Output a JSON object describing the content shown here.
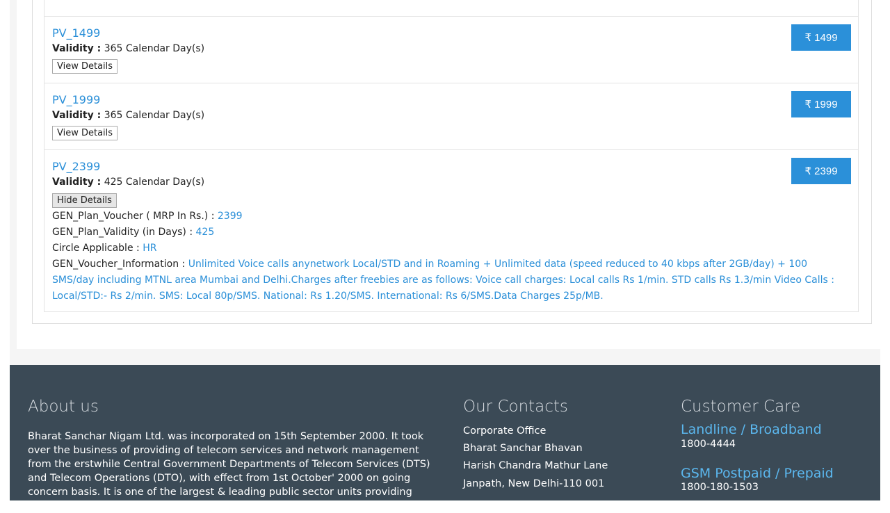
{
  "plans": [
    {
      "name": "PV_1499",
      "validity_label": "Validity :",
      "validity": "365 Calendar Day(s)",
      "button": "View Details",
      "price": "₹ 1499"
    },
    {
      "name": "PV_1999",
      "validity_label": "Validity :",
      "validity": "365 Calendar Day(s)",
      "button": "View Details",
      "price": "₹ 1999"
    },
    {
      "name": "PV_2399",
      "validity_label": "Validity :",
      "validity": "425 Calendar Day(s)",
      "button": "Hide Details",
      "price": "₹ 2399",
      "details": {
        "mrp_label": "GEN_Plan_Voucher ( MRP In Rs.) :",
        "mrp_value": "2399",
        "validity_days_label": "GEN_Plan_Validity (in Days) :",
        "validity_days_value": "425",
        "circle_label": "Circle Applicable :",
        "circle_value": "HR",
        "info_label": "GEN_Voucher_Information :",
        "info_value": "Unlimited Voice calls anynetwork Local/STD and in Roaming + Unlimited data (speed reduced to 40 kbps after 2GB/day) + 100 SMS/day including MTNL area Mumbai and Delhi.Charges after freebies are as follows: Voice call charges: Local calls Rs 1/min. STD calls Rs 1.3/min Video Calls : Local/STD:- Rs 2/min. SMS: Local 80p/SMS. National: Rs 1.20/SMS. International: Rs 6/SMS.Data Charges 25p/MB."
      }
    }
  ],
  "footer": {
    "about": {
      "heading": "About us",
      "text": "Bharat Sanchar Nigam Ltd. was incorporated on 15th September 2000. It took over the business of providing of telecom services and network management from the erstwhile Central Government Departments of Telecom Services (DTS) and Telecom Operations (DTO), with effect from 1st October' 2000 on going concern basis. It is one of the largest & leading public sector units providing comprehensive range of"
    },
    "contacts": {
      "heading": "Our Contacts",
      "lines": [
        "Corporate Office",
        "Bharat Sanchar Bhavan",
        "Harish Chandra Mathur Lane",
        "Janpath, New Delhi-110 001"
      ]
    },
    "care": {
      "heading": "Customer Care",
      "landline_label": "Landline / Broadband",
      "landline_number": "1800-4444",
      "gsm_label": "GSM Postpaid / Prepaid",
      "gsm_number": "1800-180-1503"
    }
  },
  "colors": {
    "accent": "#2b90d9",
    "link": "#2a8fd8",
    "footer_bg": "#3b4a56"
  }
}
